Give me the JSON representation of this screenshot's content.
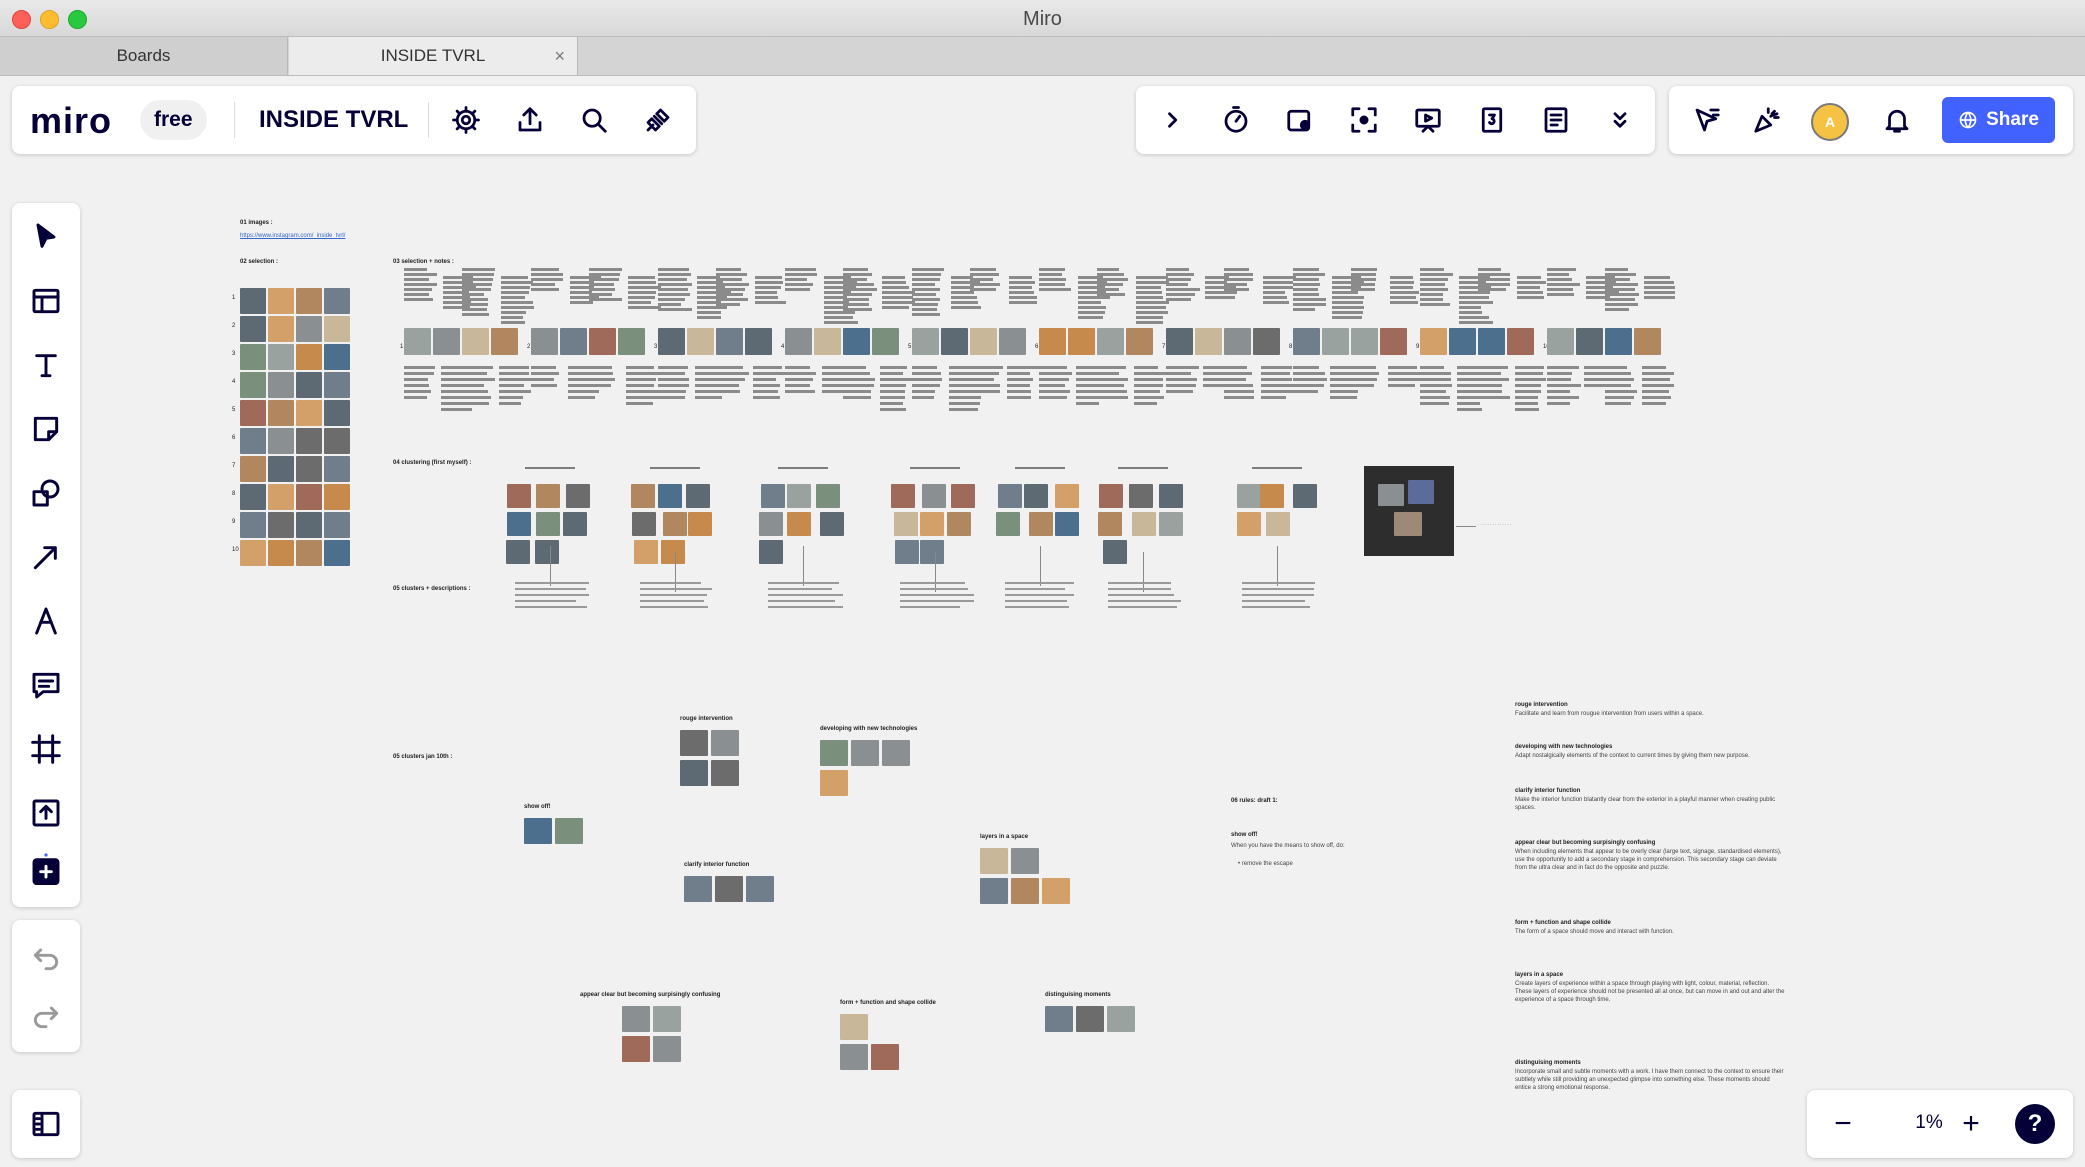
{
  "window": {
    "title": "Miro"
  },
  "tabs": [
    {
      "label": "Boards"
    },
    {
      "label": "INSIDE TVRL",
      "close": "×"
    }
  ],
  "toolbar": {
    "logo": "miro",
    "plan": "free",
    "board_name": "INSIDE TVRL",
    "left_icons": [
      "settings-icon",
      "export-icon",
      "search-icon",
      "apps-plug-icon"
    ],
    "middle_icons": [
      "chevron-right-icon",
      "timer-icon",
      "card-icon",
      "focus-icon",
      "presentation-icon",
      "countdown-icon",
      "notes-icon",
      "chevron-double-down-icon"
    ],
    "right_icons": [
      "cursor-follow-icon",
      "reactions-icon",
      "avatar",
      "bell-icon"
    ],
    "avatar_initial": "A",
    "share_label": "Share"
  },
  "left_tools": [
    "select-icon",
    "templates-icon",
    "text-icon",
    "sticky-note-icon",
    "shapes-icon",
    "arrow-icon",
    "pen-icon",
    "comment-icon",
    "frame-icon",
    "upload-icon",
    "add-more-icon"
  ],
  "undo_tools": [
    "undo-icon",
    "redo-icon"
  ],
  "zoom": {
    "value": "1%",
    "minus": "−",
    "plus": "+",
    "help": "?"
  },
  "colors": {
    "accent": "#4262ff",
    "ink": "#050038",
    "canvas": "#f1f1f1"
  },
  "board": {
    "section_01": {
      "label": "01 images :",
      "link": "https://www.instagram.com/_inside_tvrl/"
    },
    "section_02": {
      "label": "02 selection :",
      "row_numbers": [
        "1",
        "2",
        "3",
        "4",
        "5",
        "6",
        "7",
        "8",
        "9",
        "10"
      ]
    },
    "section_03": {
      "label": "03 selection + notes :",
      "group_numbers": [
        "1",
        "2",
        "3",
        "4",
        "5",
        "6",
        "7",
        "8",
        "9",
        "10"
      ]
    },
    "section_04": {
      "label": "04 clustering (first myself) :"
    },
    "section_05a": {
      "label": "05 clusters + descriptions :"
    },
    "section_05b": {
      "label": "05 clusters jan 10th :"
    },
    "clusters_jan": [
      {
        "label": "rouge intervention"
      },
      {
        "label": "developing with new technologies"
      },
      {
        "label": "show off!"
      },
      {
        "label": "clarify interior function"
      },
      {
        "label": "layers in a space"
      },
      {
        "label": "appear clear but becoming surpisingly confusing"
      },
      {
        "label": "form + function and shape collide"
      },
      {
        "label": "distinguising moments"
      }
    ],
    "rules": {
      "label": "06 rules: draft 1:",
      "title": "show off!",
      "desc": "When you have the means to show off, do:",
      "bullet": "• remove the escape"
    },
    "descriptions": [
      {
        "title": "rouge intervention",
        "text": "Facilitate and learn from rougue intervention from users within a space."
      },
      {
        "title": "developing with new technologies",
        "text": "Adapt nostalgically elements of the context to current times by giving them new purpose."
      },
      {
        "title": "clarify interior function",
        "text": "Make the interior function blatantly clear from the exterior in a playful manner when creating public spaces."
      },
      {
        "title": "appear clear but becoming surpisingly confusing",
        "text": "When including elements that appear to be overly clear (large text, signage, standardised elements), use the opportunity to add a secondary stage in comprehension. This secondary stage can deviate from the ultra clear and in fact do the opposite and puzzle."
      },
      {
        "title": "form + function and shape collide",
        "text": "The form of a space should move and interact with function."
      },
      {
        "title": "layers in a space",
        "text": "Create layers of experience within a space through playing with light, colour, material, reflection. These layers of experience should not be presented all at once, but can move in and out and alter the experience of a space through time."
      },
      {
        "title": "distinguising moments",
        "text": "Incorporate small and subtle moments with a work. I have them connect to the context to ensure their subtlety while still providing an unexpected glimpse into something else. These moments should entice a strong emotional response."
      }
    ]
  }
}
